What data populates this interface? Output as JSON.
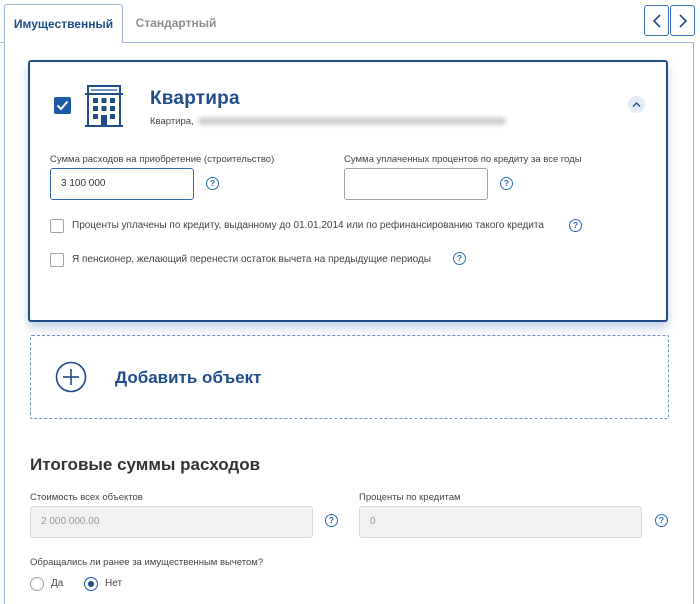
{
  "tabs": {
    "active": "Имущественный",
    "inactive": "Стандартный"
  },
  "nav": {
    "prev_icon": "chevron-left-icon",
    "next_icon": "chevron-right-icon"
  },
  "object_card": {
    "checked": true,
    "icon": "apartment-building-icon",
    "title": "Квартира",
    "address_prefix": "Квартира,",
    "expense_label": "Сумма расходов на приобретение (строительство)",
    "expense_value": "3 100 000",
    "interest_label": "Сумма уплаченных процентов по кредиту за все годы",
    "interest_value": "",
    "checkbox_pre2014": "Проценты уплачены по кредиту, выданному до 01.01.2014 или по рефинансированию такого кредита",
    "checkbox_pensioner": "Я пенсионер, желающий перенести остаток вычета на предыдущие периоды"
  },
  "help_glyph": "?",
  "add_object": {
    "label": "Добавить объект",
    "icon": "plus-circle-icon"
  },
  "totals": {
    "title": "Итоговые суммы расходов",
    "all_objects_label": "Стоимость всех объектов",
    "all_objects_value": "2 000 000.00",
    "interest_label": "Проценты по кредитам",
    "interest_value": "0",
    "question": "Обращались ли ранее за имущественным вычетом?",
    "options": [
      "Да",
      "Нет"
    ],
    "selected": "Нет"
  },
  "colors": {
    "brand": "#1f4d8a",
    "accent": "#2c69b3",
    "border": "#9bb6d6"
  }
}
